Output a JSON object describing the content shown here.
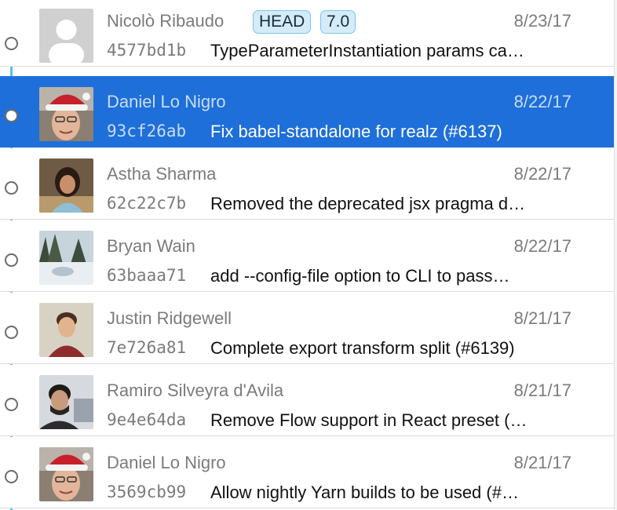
{
  "commits": [
    {
      "author": "Nicolò Ribaudo",
      "date": "8/23/17",
      "hash": "4577bd1b",
      "message": "TypeParameterInstantiation params ca…",
      "refs": [
        "HEAD",
        "7.0"
      ],
      "avatar": "default-avatar-icon",
      "selected": false
    },
    {
      "author": "Daniel Lo Nigro",
      "date": "8/22/17",
      "hash": "93cf26ab",
      "message": "Fix babel-standalone for realz (#6137)",
      "refs": [],
      "avatar": "santa-hat-avatar",
      "selected": true
    },
    {
      "author": "Astha Sharma",
      "date": "8/22/17",
      "hash": "62c22c7b",
      "message": "Removed the deprecated jsx pragma d…",
      "refs": [],
      "avatar": "photo-avatar",
      "selected": false
    },
    {
      "author": "Bryan Wain",
      "date": "8/22/17",
      "hash": "63baaa71",
      "message": "add --config-file option to CLI to pass…",
      "refs": [],
      "avatar": "landscape-avatar",
      "selected": false
    },
    {
      "author": "Justin Ridgewell",
      "date": "8/21/17",
      "hash": "7e726a81",
      "message": "Complete export transform split (#6139)",
      "refs": [],
      "avatar": "photo-avatar",
      "selected": false
    },
    {
      "author": "Ramiro Silveyra d'Avila",
      "date": "8/21/17",
      "hash": "9e4e64da",
      "message": "Remove Flow support in React preset (…",
      "refs": [],
      "avatar": "photo-avatar",
      "selected": false
    },
    {
      "author": "Daniel Lo Nigro",
      "date": "8/21/17",
      "hash": "3569cb99",
      "message": "Allow nightly Yarn builds to be used (#…",
      "refs": [],
      "avatar": "santa-hat-avatar",
      "selected": false
    }
  ],
  "colors": {
    "selection": "#1e6fd9",
    "graph_line": "#57c0ea",
    "badge_fill": "#d4ecf9",
    "badge_border": "#7cc3ea"
  }
}
